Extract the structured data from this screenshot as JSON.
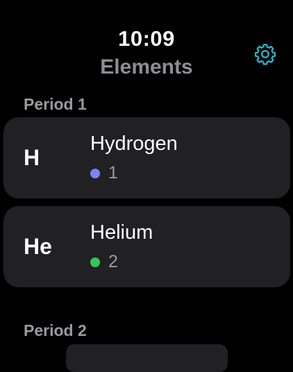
{
  "status": {
    "time": "10:09"
  },
  "nav": {
    "title": "Elements",
    "settings_icon": "gear-icon",
    "accent": "#30b0c7"
  },
  "sections": [
    {
      "header": "Period 1",
      "items": [
        {
          "symbol": "H",
          "name": "Hydrogen",
          "number": "1",
          "dot_color": "#7b83f7"
        },
        {
          "symbol": "He",
          "name": "Helium",
          "number": "2",
          "dot_color": "#34c759"
        }
      ]
    },
    {
      "header": "Period 2",
      "items": []
    }
  ]
}
